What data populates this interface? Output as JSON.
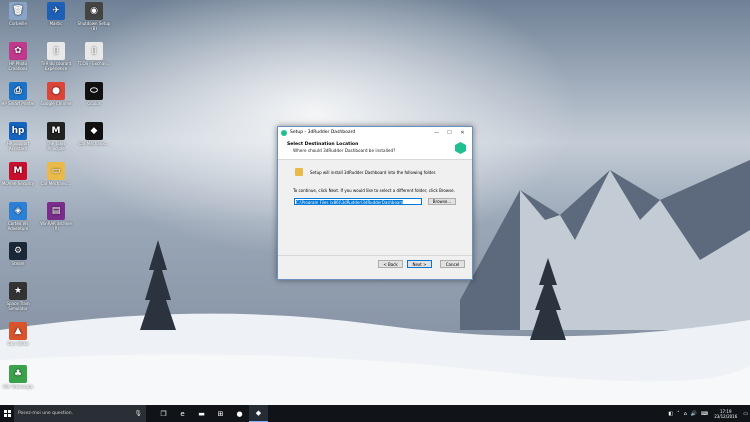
{
  "desktop": {
    "icons": [
      {
        "label": "Corbeille",
        "icon": "recycle-bin-icon",
        "color": "#8aa4c8",
        "glyph": "🗑"
      },
      {
        "label": "Mastic",
        "icon": "bird-app-icon",
        "color": "#1e5fb8",
        "glyph": "✈"
      },
      {
        "label": "Shutdown Setup (B)",
        "icon": "panda-app-icon",
        "color": "#444444",
        "glyph": "◉"
      },
      {
        "label": "HP Photo Creations",
        "icon": "hp-photo-icon",
        "color": "#c0398d",
        "glyph": "✿"
      },
      {
        "label": "Tiré du courant Expérience",
        "icon": "document-icon",
        "color": "#e8e8e8",
        "glyph": "▯"
      },
      {
        "label": "TCOS - Exchan...",
        "icon": "document-icon",
        "color": "#e8e8e8",
        "glyph": "▯"
      },
      {
        "label": "HP Smart Printer",
        "icon": "hp-smart-icon",
        "color": "#1a73c8",
        "glyph": "⎙"
      },
      {
        "label": "Google Chrome",
        "icon": "chrome-icon",
        "color": "#db4437",
        "glyph": "●"
      },
      {
        "label": "Oculus",
        "icon": "oculus-icon",
        "color": "#111111",
        "glyph": "⬭"
      },
      {
        "label": "HP Support Assistant",
        "icon": "hp-icon",
        "color": "#1565c0",
        "glyph": "hp"
      },
      {
        "label": "The Talos Principle",
        "icon": "malwarebytes-icon",
        "color": "#222222",
        "glyph": "M"
      },
      {
        "label": "Car Mechanic...",
        "icon": "unity-icon",
        "color": "#111111",
        "glyph": "◆"
      },
      {
        "label": "McAfee Security",
        "icon": "mcafee-icon",
        "color": "#c8102e",
        "glyph": "M"
      },
      {
        "label": "Car Mechanic...",
        "icon": "folder-icon",
        "color": "#e9b949",
        "glyph": "▭"
      },
      {
        "label": "Cortex VR Adventure",
        "icon": "vr-app-icon",
        "color": "#2b7fd4",
        "glyph": "◈"
      },
      {
        "label": "WinRAR archive (R)",
        "icon": "winrar-icon",
        "color": "#7a2d8a",
        "glyph": "▤"
      },
      {
        "label": "Steam",
        "icon": "steam-icon",
        "color": "#1b2838",
        "glyph": "⚙"
      },
      {
        "label": "Space Train Simulator",
        "icon": "game-icon",
        "color": "#333333",
        "glyph": "★"
      },
      {
        "label": "Gun Strike",
        "icon": "gun-strike-icon",
        "color": "#d9532b",
        "glyph": "▲"
      },
      {
        "label": "Idle Townscape",
        "icon": "game-icon-2",
        "color": "#3aa34a",
        "glyph": "♣"
      }
    ]
  },
  "window": {
    "title": "Setup - 3dRudder Dashboard",
    "controls": {
      "minimize": "—",
      "maximize": "☐",
      "close": "✕"
    },
    "header_title": "Select Destination Location",
    "header_subtitle": "Where should 3dRudder Dashboard be installed?",
    "install_text": "Setup will install 3dRudder Dashboard into the following folder.",
    "continue_text": "To continue, click Next. If you would like to select a different folder, click Browse.",
    "path_value": "C:\\Program Files (x86)\\3dRudder\\3dRudderDashboard",
    "browse_label": "Browse...",
    "space_text": "At least 337,3 MB of free disk space is required.",
    "back_label": "< Back",
    "next_label": "Next >",
    "cancel_label": "Cancel",
    "accent": "#1fbf8f"
  },
  "taskbar": {
    "search_placeholder": "Posez-moi une question.",
    "time": "17:19",
    "date": "23/12/2016",
    "pinned": [
      {
        "icon": "task-view-icon",
        "glyph": "❐"
      },
      {
        "icon": "edge-icon",
        "glyph": "e"
      },
      {
        "icon": "file-explorer-icon",
        "glyph": "▬"
      },
      {
        "icon": "store-icon",
        "glyph": "⊞"
      },
      {
        "icon": "chrome-icon",
        "glyph": "●"
      },
      {
        "icon": "3drudder-setup-icon",
        "glyph": "◆"
      }
    ]
  }
}
